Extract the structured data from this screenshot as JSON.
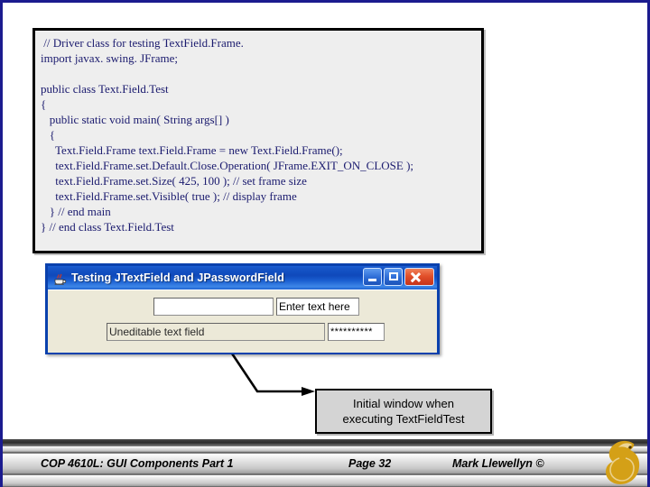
{
  "slide": {
    "border_color": "#1b1b8f",
    "background": "#ffffff"
  },
  "code_block": {
    "title": "TextFieldTest.java driver class source code",
    "text_color": "#1a1a6e",
    "background": "#eeeeee",
    "lines": [
      " // Driver class for testing TextField.Frame.",
      "import javax. swing. JFrame;",
      "",
      "public class Text.Field.Test",
      "{",
      "   public static void main( String args[] )",
      "   {",
      "     Text.Field.Frame text.Field.Frame = new Text.Field.Frame();",
      "     text.Field.Frame.set.Default.Close.Operation( JFrame.EXIT_ON_CLOSE );",
      "     text.Field.Frame.set.Size( 425, 100 ); // set frame size",
      "     text.Field.Frame.set.Visible( true ); // display frame",
      "   } // end main",
      "} // end class Text.Field.Test"
    ]
  },
  "jframe": {
    "title": "Testing JTextField and JPasswordField",
    "icon": "java-coffee-cup-icon",
    "titlebar_color": "#0f49bb",
    "content_background": "#ece9d8",
    "buttons": {
      "minimize": "minimize-icon",
      "maximize": "maximize-icon",
      "close": "close-icon"
    },
    "fields": {
      "text_field_value": "",
      "enter_text_value": "Enter text here",
      "uneditable_value": "Uneditable text field",
      "password_value": "**********"
    }
  },
  "caption": {
    "line1": "Initial window when",
    "line2": "executing TextFieldTest"
  },
  "footer": {
    "course": "COP 4610L: GUI Components Part 1",
    "page": "Page 32",
    "author": "Mark Llewellyn ©",
    "logo": "ucf-pegasus-logo",
    "logo_color": "#d4a017"
  }
}
